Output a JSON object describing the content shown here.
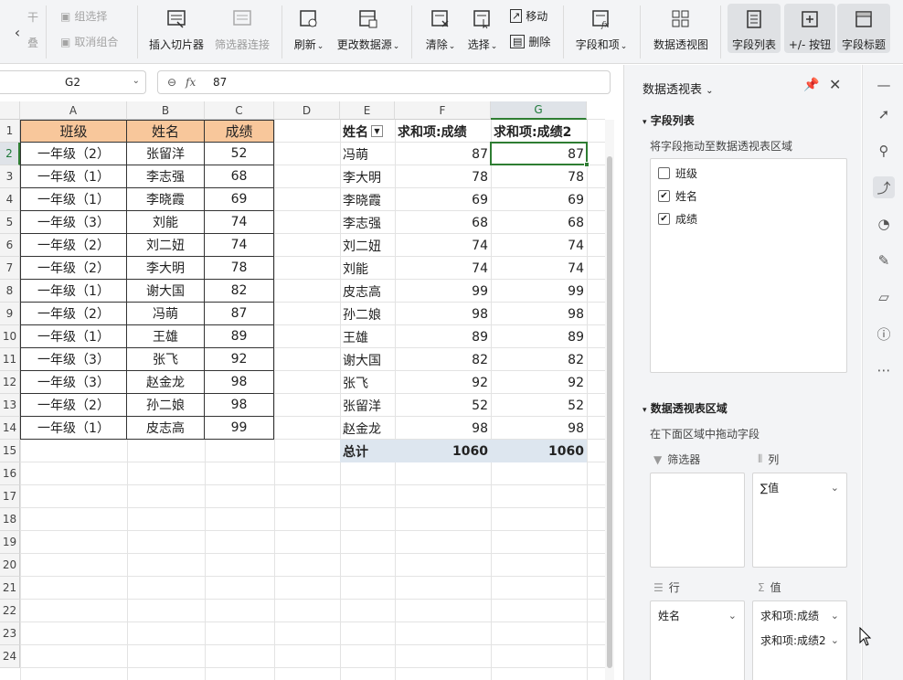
{
  "ribbon": {
    "partial_top": "干",
    "partial_bottom": "叠",
    "group_label": "组选择",
    "ungroup_label": "取消组合",
    "insert_slicer": "插入切片器",
    "filter_connect": "筛选器连接",
    "refresh": "刷新",
    "change_source": "更改数据源",
    "clear": "清除",
    "select": "选择",
    "move": "移动",
    "delete": "删除",
    "fields_items": "字段和项",
    "pivot_view": "数据透视图",
    "field_list": "字段列表",
    "plus_minus": "+/- 按钮",
    "field_headers": "字段标题"
  },
  "formula_bar": {
    "cell_ref": "G2",
    "value": "87",
    "fx": "fx"
  },
  "columns": [
    "A",
    "B",
    "C",
    "D",
    "E",
    "F",
    "G"
  ],
  "rows": [
    "1",
    "2",
    "3",
    "4",
    "5",
    "6",
    "7",
    "8",
    "9",
    "10",
    "11",
    "12",
    "13",
    "14",
    "15",
    "16",
    "17",
    "18",
    "19",
    "20",
    "21",
    "22",
    "23",
    "24"
  ],
  "source_table": {
    "headers": [
      "班级",
      "姓名",
      "成绩"
    ],
    "rows": [
      [
        "一年级（2）",
        "张留洋",
        "52"
      ],
      [
        "一年级（1）",
        "李志强",
        "68"
      ],
      [
        "一年级（1）",
        "李晓霞",
        "69"
      ],
      [
        "一年级（3）",
        "刘能",
        "74"
      ],
      [
        "一年级（2）",
        "刘二妞",
        "74"
      ],
      [
        "一年级（2）",
        "李大明",
        "78"
      ],
      [
        "一年级（1）",
        "谢大国",
        "82"
      ],
      [
        "一年级（2）",
        "冯萌",
        "87"
      ],
      [
        "一年级（1）",
        "王雄",
        "89"
      ],
      [
        "一年级（3）",
        "张飞",
        "92"
      ],
      [
        "一年级（3）",
        "赵金龙",
        "98"
      ],
      [
        "一年级（2）",
        "孙二娘",
        "98"
      ],
      [
        "一年级（1）",
        "皮志高",
        "99"
      ]
    ]
  },
  "pivot_table": {
    "headers": [
      "姓名",
      "求和项:成绩",
      "求和项:成绩2"
    ],
    "rows": [
      [
        "冯萌",
        "87",
        "87"
      ],
      [
        "李大明",
        "78",
        "78"
      ],
      [
        "李晓霞",
        "69",
        "69"
      ],
      [
        "李志强",
        "68",
        "68"
      ],
      [
        "刘二妞",
        "74",
        "74"
      ],
      [
        "刘能",
        "74",
        "74"
      ],
      [
        "皮志高",
        "99",
        "99"
      ],
      [
        "孙二娘",
        "98",
        "98"
      ],
      [
        "王雄",
        "89",
        "89"
      ],
      [
        "谢大国",
        "82",
        "82"
      ],
      [
        "张飞",
        "92",
        "92"
      ],
      [
        "张留洋",
        "52",
        "52"
      ],
      [
        "赵金龙",
        "98",
        "98"
      ]
    ],
    "total": [
      "总计",
      "1060",
      "1060"
    ]
  },
  "pane": {
    "title": "数据透视表",
    "field_list_title": "字段列表",
    "field_list_hint": "将字段拖动至数据透视表区域",
    "fields": [
      {
        "label": "班级",
        "checked": false
      },
      {
        "label": "姓名",
        "checked": true
      },
      {
        "label": "成绩",
        "checked": true
      }
    ],
    "area_title": "数据透视表区域",
    "area_hint": "在下面区域中拖动字段",
    "filter_label": "筛选器",
    "column_label": "列",
    "row_label": "行",
    "value_label": "值",
    "column_chip": "∑值",
    "row_chip": "姓名",
    "value_chips": [
      "求和项:成绩",
      "求和项:成绩2"
    ]
  },
  "colors": {
    "header_fill": "#f8c79b",
    "total_fill": "#dde6ef",
    "selection": "#2e7d32"
  }
}
